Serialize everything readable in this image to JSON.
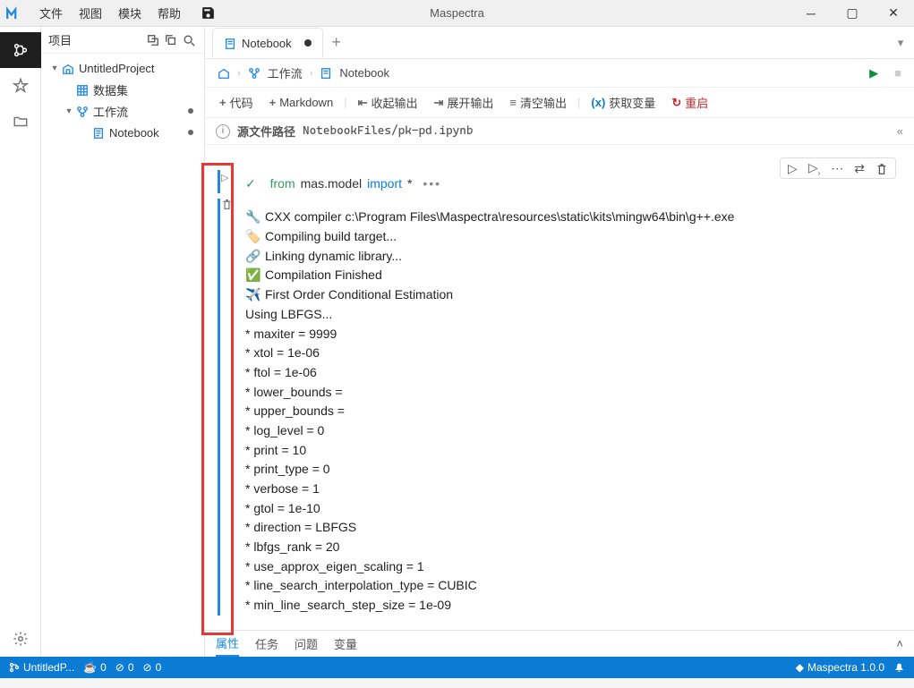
{
  "app": {
    "title": "Maspectra"
  },
  "menu": {
    "file": "文件",
    "view": "视图",
    "module": "模块",
    "help": "帮助"
  },
  "sidebar": {
    "title": "项目",
    "tree": {
      "project": "UntitledProject",
      "dataset": "数据集",
      "workflow": "工作流",
      "notebook": "Notebook"
    }
  },
  "tab": {
    "label": "Notebook"
  },
  "breadcrumb": {
    "workflow": "工作流",
    "notebook": "Notebook"
  },
  "toolbar": {
    "code": "代码",
    "markdown": "Markdown",
    "collapse": "收起输出",
    "expand": "展开输出",
    "clear": "清空输出",
    "vars": "获取变量",
    "restart": "重启"
  },
  "srcbar": {
    "label": "源文件路径",
    "path": "NotebookFiles/pk-pd.ipynb"
  },
  "code": {
    "from": "from",
    "mod": "mas.model",
    "import": "import",
    "star": "*"
  },
  "out": {
    "l1": "CXX compiler c:\\Program Files\\Maspectra\\resources\\static\\kits\\mingw64\\bin\\g++.exe",
    "l2": "Compiling build target...",
    "l3": "Linking dynamic library...",
    "l4": "Compilation Finished",
    "l5": "First Order Conditional Estimation",
    "l6": "Using LBFGS...",
    "l7": "* maxiter = 9999",
    "l8": "* xtol = 1e-06",
    "l9": "* ftol = 1e-06",
    "l10": "* lower_bounds =",
    "l11": "* upper_bounds =",
    "l12": "* log_level = 0",
    "l13": "* print = 10",
    "l14": "* print_type = 0",
    "l15": "* verbose = 1",
    "l16": "* gtol = 1e-10",
    "l17": "* direction = LBFGS",
    "l18": "* lbfgs_rank = 20",
    "l19": "* use_approx_eigen_scaling = 1",
    "l20": "* line_search_interpolation_type = CUBIC",
    "l21": "* min_line_search_step_size = 1e-09"
  },
  "btabs": {
    "props": "属性",
    "tasks": "任务",
    "problems": "问题",
    "vars": "变量"
  },
  "status": {
    "project": "UntitledP...",
    "brand": "Maspectra 1.0.0",
    "zero": "0"
  }
}
